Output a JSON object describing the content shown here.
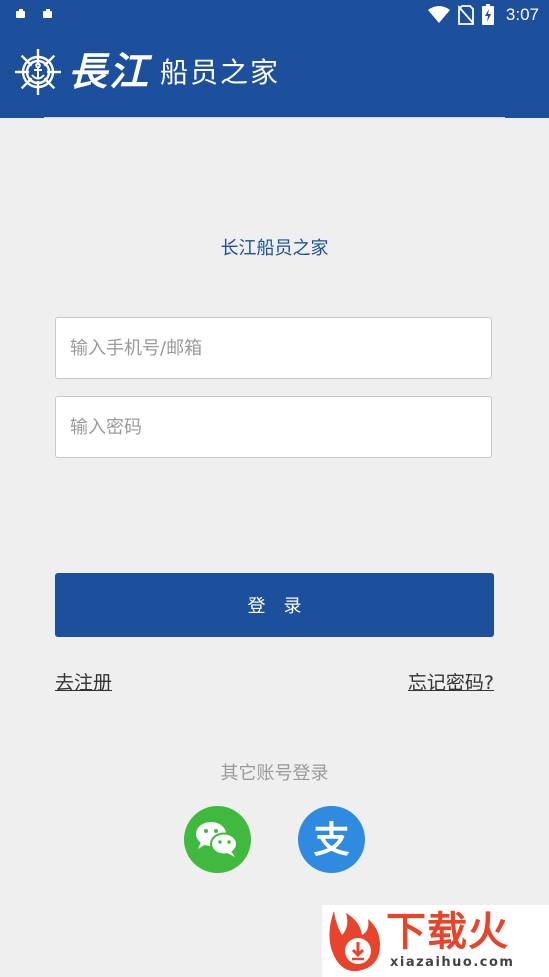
{
  "status_bar": {
    "time": "3:07"
  },
  "app_bar": {
    "logo_big": "長江",
    "logo_small": "船员之家"
  },
  "main": {
    "title": "长江船员之家",
    "phone_placeholder": "输入手机号/邮箱",
    "password_placeholder": "输入密码",
    "login_label": "登　录",
    "register_link": "去注册",
    "forgot_link": "忘记密码?",
    "other_login_label": "其它账号登录",
    "social": [
      "wechat-icon",
      "alipay-icon"
    ]
  },
  "watermark": {
    "brand": "下载火",
    "url": "xiazaihuo.com"
  },
  "colors": {
    "primary": "#1c4f9c",
    "background": "#efefef",
    "wechat": "#3fba3f",
    "alipay": "#2f8be0",
    "watermark": "#e8442c"
  }
}
